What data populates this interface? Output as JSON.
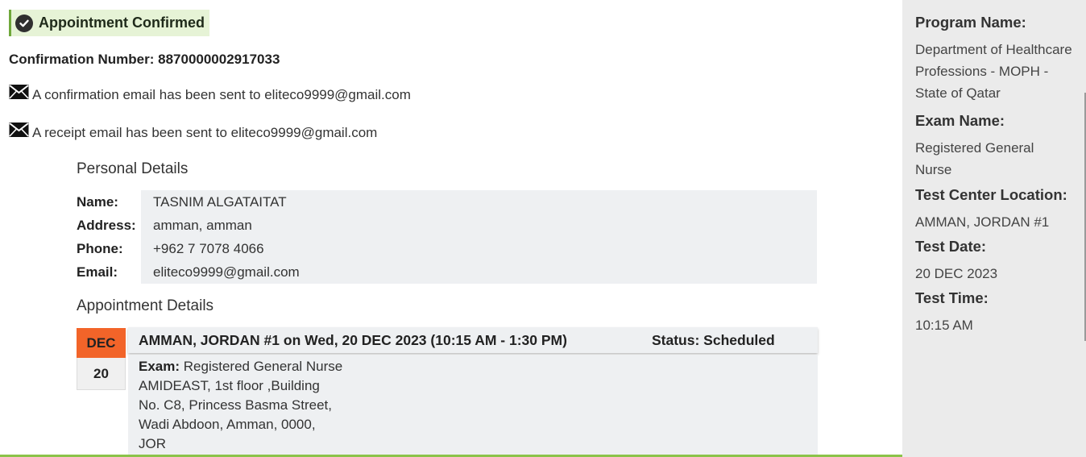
{
  "banner": {
    "title": "Appointment Confirmed"
  },
  "confirmation": {
    "label": "Confirmation Number:",
    "number": "8870000002917033"
  },
  "emails": {
    "confirmation_text": "A confirmation email has been sent to eliteco9999@gmail.com",
    "receipt_text": "A receipt email has been sent to eliteco9999@gmail.com"
  },
  "personal": {
    "heading": "Personal Details",
    "labels": {
      "name": "Name:",
      "address": "Address:",
      "phone": "Phone:",
      "email": "Email:"
    },
    "values": {
      "name": "TASNIM ALGATAITAT",
      "address": "amman, amman",
      "phone": "+962 7 7078 4066",
      "email": "eliteco9999@gmail.com"
    }
  },
  "appointment": {
    "heading": "Appointment Details",
    "month": "DEC",
    "day": "20",
    "summary": "AMMAN, JORDAN #1 on Wed, 20 DEC 2023 (10:15 AM - 1:30 PM)",
    "status": "Status: Scheduled",
    "exam_label": "Exam:",
    "exam_value": "Registered General Nurse",
    "address_lines": [
      "AMIDEAST, 1st floor ,Building",
      "No. C8, Princess Basma Street,",
      "Wadi Abdoon, Amman, 0000,",
      "JOR"
    ]
  },
  "sidebar": {
    "program_label": "Program Name:",
    "program_value": "Department of Healthcare Professions - MOPH - State of Qatar",
    "exam_label": "Exam Name:",
    "exam_value": "Registered General Nurse",
    "location_label": "Test Center Location:",
    "location_value": "AMMAN, JORDAN #1",
    "date_label": "Test Date:",
    "date_value": "20 DEC 2023",
    "time_label": "Test Time:",
    "time_value": "10:15 AM"
  },
  "colors": {
    "accent_green": "#6fa83b",
    "banner_bg": "#e6f3d6",
    "month_orange": "#f26429",
    "panel_bg": "#eef0f2",
    "sidebar_bg": "#ebebeb"
  },
  "icons": [
    "check-circle-icon",
    "envelope-icon"
  ]
}
